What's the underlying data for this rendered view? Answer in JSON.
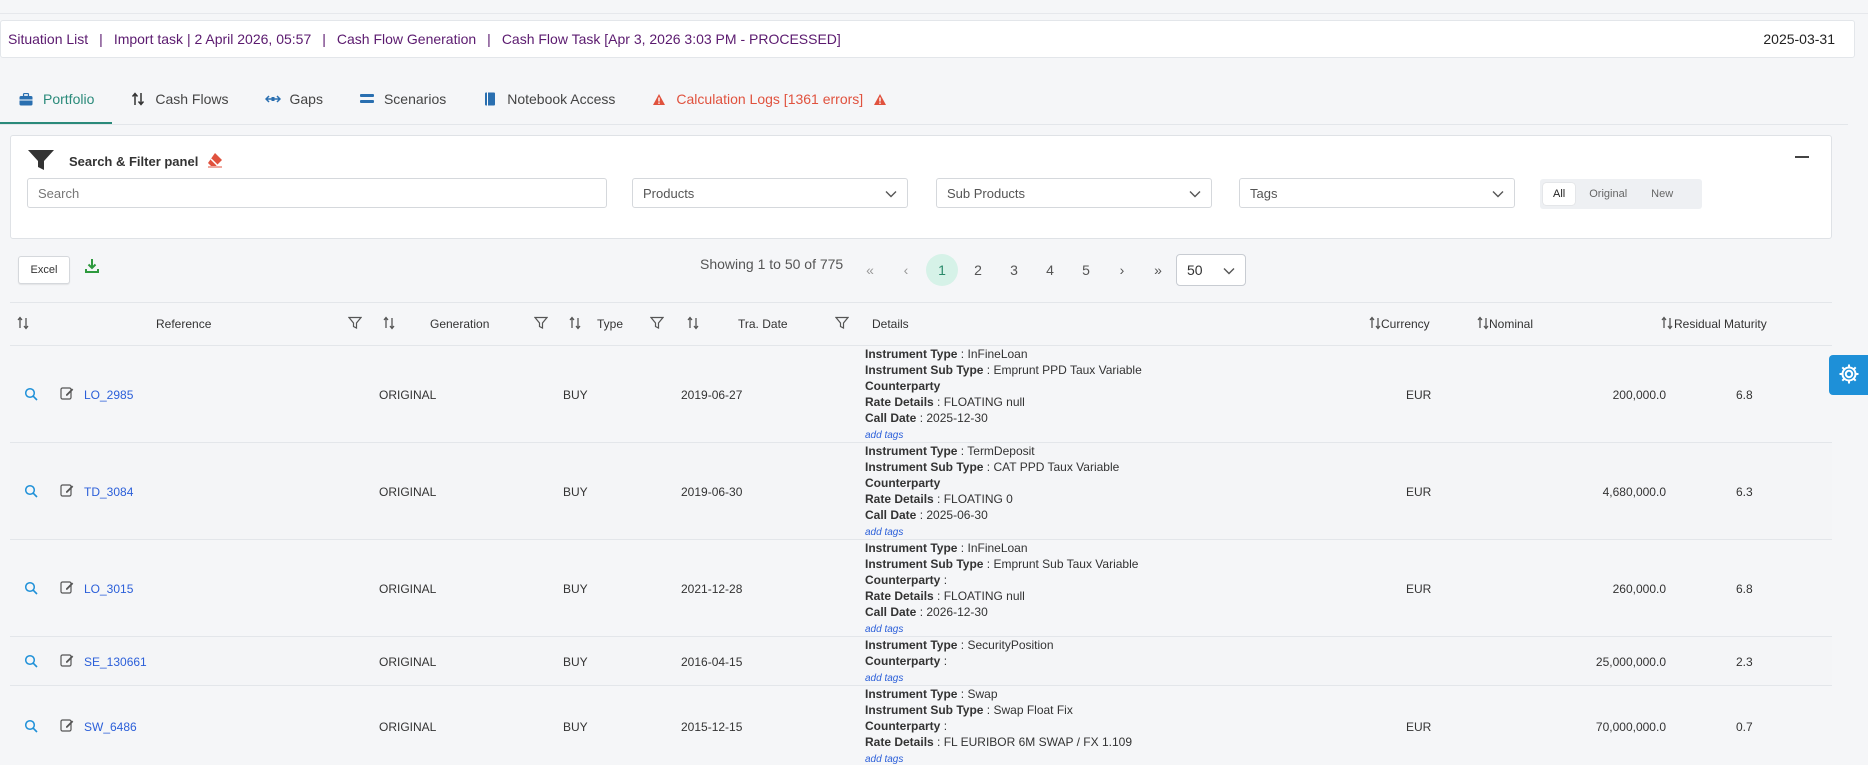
{
  "breadcrumb": {
    "items": [
      "Situation List",
      "Import task | 2 April 2026, 05:57",
      "Cash Flow Generation",
      "Cash Flow Task [Apr 3, 2026 3:03 PM - PROCESSED]"
    ],
    "separator": "|",
    "date": "2025-03-31"
  },
  "tabs": [
    {
      "label": "Portfolio",
      "icon": "briefcase-icon",
      "active": true
    },
    {
      "label": "Cash Flows",
      "icon": "sort-arrows-icon"
    },
    {
      "label": "Gaps",
      "icon": "arrows-horizontal-icon"
    },
    {
      "label": "Scenarios",
      "icon": "stack-icon"
    },
    {
      "label": "Notebook Access",
      "icon": "notebook-icon"
    },
    {
      "label": "Calculation Logs [1361 errors]",
      "icon": "warning-icon",
      "status": "error"
    }
  ],
  "filter_panel": {
    "title": "Search & Filter panel",
    "search_placeholder": "Search",
    "dropdowns": [
      "Products",
      "Sub Products",
      "Tags"
    ],
    "segments": [
      "All",
      "Original",
      "New"
    ],
    "active_segment": "All"
  },
  "toolbar": {
    "excel_label": "Excel",
    "showing": "Showing 1 to 50 of 775",
    "pages": [
      "1",
      "2",
      "3",
      "4",
      "5"
    ],
    "current_page": "1",
    "first": "«",
    "prev": "‹",
    "next": "›",
    "last": "»",
    "per_page": "50"
  },
  "table": {
    "columns": {
      "reference": "Reference",
      "generation": "Generation",
      "type": "Type",
      "tra_date": "Tra. Date",
      "details": "Details",
      "currency": "Currency",
      "nominal": "Nominal",
      "residual_maturity": "Residual Maturity"
    },
    "detail_labels": {
      "instrument_type": "Instrument Type",
      "instrument_sub_type": "Instrument Sub Type",
      "counterparty": "Counterparty",
      "rate_details": "Rate Details",
      "call_date": "Call Date",
      "add_tags": "add tags"
    },
    "rows": [
      {
        "reference": "LO_2985",
        "generation": "ORIGINAL",
        "type": "BUY",
        "tra_date": "2019-06-27",
        "instrument_type": "InFineLoan",
        "instrument_sub_type": "Emprunt PPD Taux Variable",
        "counterparty": "",
        "rate_details": "FLOATING null",
        "call_date": "2025-12-30",
        "currency": "EUR",
        "nominal": "200,000.0",
        "residual_maturity": "6.8"
      },
      {
        "reference": "TD_3084",
        "generation": "ORIGINAL",
        "type": "BUY",
        "tra_date": "2019-06-30",
        "instrument_type": "TermDeposit",
        "instrument_sub_type": "CAT PPD Taux Variable",
        "counterparty": "",
        "rate_details": "FLOATING 0",
        "call_date": "2025-06-30",
        "currency": "EUR",
        "nominal": "4,680,000.0",
        "residual_maturity": "6.3"
      },
      {
        "reference": "LO_3015",
        "generation": "ORIGINAL",
        "type": "BUY",
        "tra_date": "2021-12-28",
        "instrument_type": "InFineLoan",
        "instrument_sub_type": "Emprunt Sub Taux Variable",
        "counterparty": ":",
        "rate_details": "FLOATING null",
        "call_date": "2026-12-30",
        "currency": "EUR",
        "nominal": "260,000.0",
        "residual_maturity": "6.8"
      },
      {
        "reference": "SE_130661",
        "generation": "ORIGINAL",
        "type": "BUY",
        "tra_date": "2016-04-15",
        "instrument_type": "SecurityPosition",
        "counterparty": ":",
        "currency": "",
        "nominal": "25,000,000.0",
        "residual_maturity": "2.3"
      },
      {
        "reference": "SW_6486",
        "generation": "ORIGINAL",
        "type": "BUY",
        "tra_date": "2015-12-15",
        "instrument_type": "Swap",
        "instrument_sub_type": "Swap Float Fix",
        "counterparty": ":",
        "rate_details": "FL EURIBOR 6M SWAP / FX 1.109",
        "currency": "EUR",
        "nominal": "70,000,000.0",
        "residual_maturity": "0.7"
      }
    ]
  },
  "colors": {
    "breadcrumb": "#5b1a6f",
    "active_tab": "#2a8a7a",
    "error": "#e0523e",
    "link": "#2b5fd9",
    "settings_button": "#1e90d8"
  }
}
